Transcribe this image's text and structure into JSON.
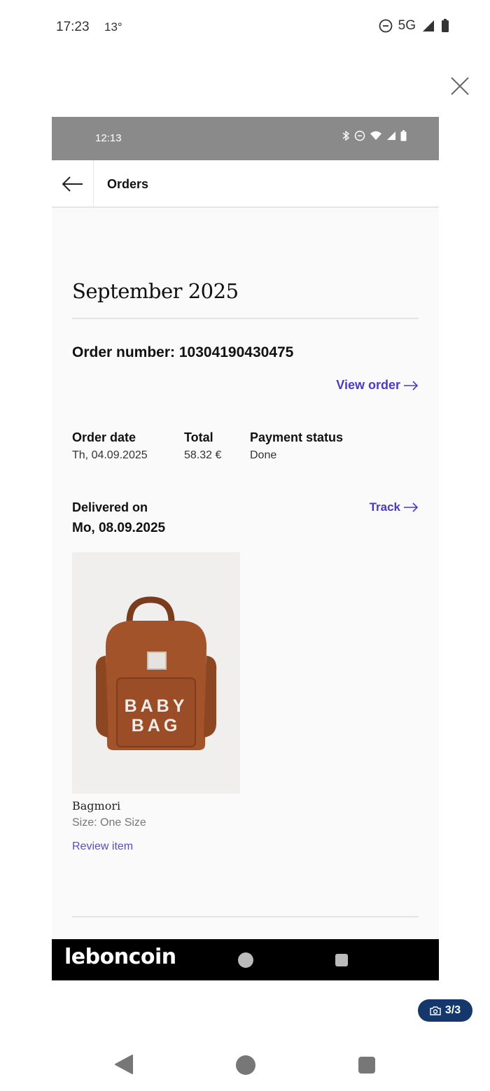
{
  "outer_status": {
    "time": "17:23",
    "temperature": "13°",
    "network": "5G"
  },
  "inner_status": {
    "time": "12:13"
  },
  "topbar": {
    "title": "Orders"
  },
  "orders": {
    "month_heading": "September 2025",
    "order_number_text": "Order number: 10304190430475",
    "view_order_label": "View order",
    "order_date_label": "Order date",
    "order_date_value": "Th, 04.09.2025",
    "total_label": "Total",
    "total_value": "58.32 €",
    "payment_status_label": "Payment status",
    "payment_status_value": "Done",
    "delivered_label": "Delivered on",
    "delivered_date": "Mo, 08.09.2025",
    "track_label": "Track"
  },
  "product": {
    "image_text_line1": "BABY",
    "image_text_line2": "BAG",
    "brand": "Bagmori",
    "size": "Size: One Size",
    "review_label": "Review item"
  },
  "watermark": "leboncoin",
  "photo_counter": "3/3",
  "colors": {
    "accent_link": "#4a3ac4",
    "badge_bg": "#14386b",
    "bag_brown": "#a2532a"
  }
}
